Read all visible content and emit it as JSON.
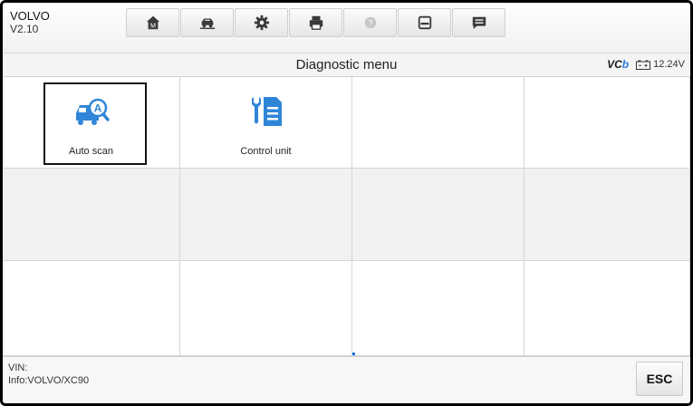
{
  "header": {
    "app_name": "VOLVO",
    "version": "V2.10",
    "toolbar_icons": [
      "home-icon",
      "vehicle-swap-icon",
      "gear-icon",
      "printer-icon",
      "help-icon",
      "save-icon",
      "message-icon"
    ]
  },
  "titlebar": {
    "title": "Diagnostic menu",
    "vci_logo_prefix": "VC",
    "vci_logo_suffix": "b",
    "voltage": "12.24V"
  },
  "functions": [
    {
      "label": "Auto scan",
      "icon": "car-scan-icon",
      "selected": true
    },
    {
      "label": "Control unit",
      "icon": "control-unit-icon",
      "selected": false
    }
  ],
  "footer": {
    "vin": "VIN:",
    "info": "Info:VOLVO/XC90",
    "esc_label": "ESC"
  },
  "colors": {
    "accent": "#2a7de1",
    "icon_blue": "#2f86d8",
    "grid_gray": "#f1f1f1"
  }
}
